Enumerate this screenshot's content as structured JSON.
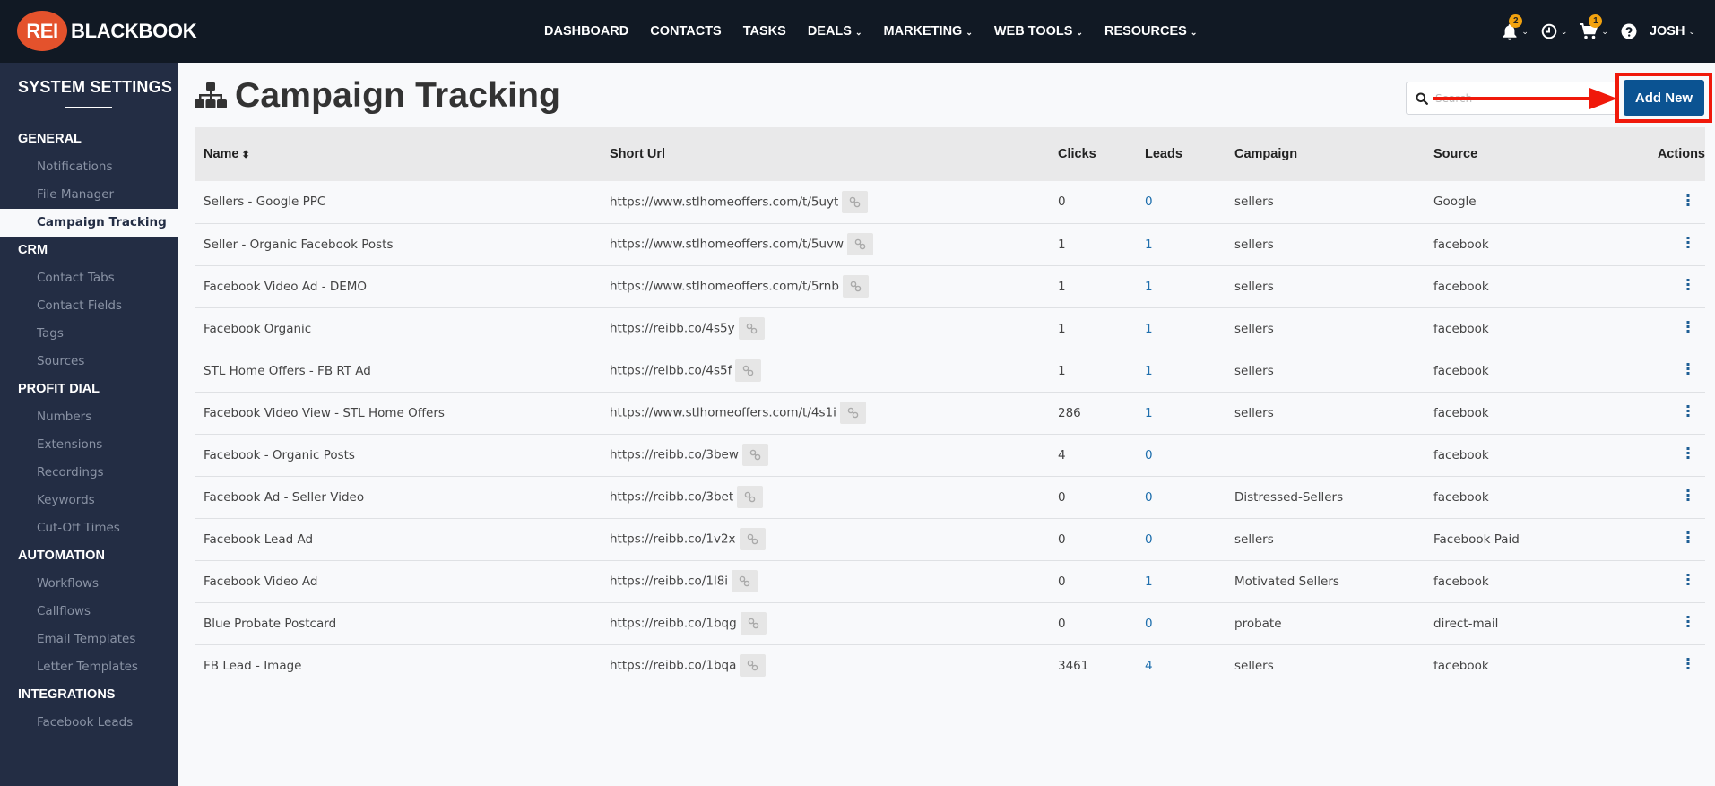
{
  "brand": {
    "logo_mark": "REI",
    "logo_text": "BLACKBOOK",
    "logo_color": "#e4522c"
  },
  "topnav": {
    "items": [
      {
        "label": "DASHBOARD",
        "dropdown": false
      },
      {
        "label": "CONTACTS",
        "dropdown": false
      },
      {
        "label": "TASKS",
        "dropdown": false
      },
      {
        "label": "DEALS",
        "dropdown": true
      },
      {
        "label": "MARKETING",
        "dropdown": true
      },
      {
        "label": "WEB TOOLS",
        "dropdown": true
      },
      {
        "label": "RESOURCES",
        "dropdown": true
      }
    ],
    "caret": "⌄",
    "notifications_badge": "2",
    "cart_badge": "1",
    "user_name": "JOSH"
  },
  "sidebar": {
    "title": "SYSTEM SETTINGS",
    "sections": [
      {
        "label": "GENERAL",
        "items": [
          {
            "label": "Notifications",
            "active": false
          },
          {
            "label": "File Manager",
            "active": false
          },
          {
            "label": "Campaign Tracking",
            "active": true
          }
        ]
      },
      {
        "label": "CRM",
        "items": [
          {
            "label": "Contact Tabs",
            "active": false
          },
          {
            "label": "Contact Fields",
            "active": false
          },
          {
            "label": "Tags",
            "active": false
          },
          {
            "label": "Sources",
            "active": false
          }
        ]
      },
      {
        "label": "PROFIT DIAL",
        "items": [
          {
            "label": "Numbers",
            "active": false
          },
          {
            "label": "Extensions",
            "active": false
          },
          {
            "label": "Recordings",
            "active": false
          },
          {
            "label": "Keywords",
            "active": false
          },
          {
            "label": "Cut-Off Times",
            "active": false
          }
        ]
      },
      {
        "label": "AUTOMATION",
        "items": [
          {
            "label": "Workflows",
            "active": false
          },
          {
            "label": "Callflows",
            "active": false
          },
          {
            "label": "Email Templates",
            "active": false
          },
          {
            "label": "Letter Templates",
            "active": false
          }
        ]
      },
      {
        "label": "INTEGRATIONS",
        "items": [
          {
            "label": "Facebook Leads",
            "active": false
          }
        ]
      }
    ]
  },
  "main": {
    "title": "Campaign Tracking",
    "search_placeholder": "Search",
    "add_new_label": "Add New",
    "accent_color": "#0b5392",
    "annotation_color": "#f0190b",
    "table": {
      "columns": {
        "name": "Name",
        "short_url": "Short Url",
        "clicks": "Clicks",
        "leads": "Leads",
        "campaign": "Campaign",
        "source": "Source",
        "actions": "Actions"
      },
      "sort_icon": "⬍",
      "rows": [
        {
          "name": "Sellers - Google PPC",
          "short_url": "https://www.stlhomeoffers.com/t/5uyt",
          "clicks": "0",
          "leads": "0",
          "campaign": "sellers",
          "source": "Google"
        },
        {
          "name": "Seller - Organic Facebook Posts",
          "short_url": "https://www.stlhomeoffers.com/t/5uvw",
          "clicks": "1",
          "leads": "1",
          "campaign": "sellers",
          "source": "facebook"
        },
        {
          "name": "Facebook Video Ad - DEMO",
          "short_url": "https://www.stlhomeoffers.com/t/5rnb",
          "clicks": "1",
          "leads": "1",
          "campaign": "sellers",
          "source": "facebook"
        },
        {
          "name": "Facebook Organic",
          "short_url": "https://reibb.co/4s5y",
          "clicks": "1",
          "leads": "1",
          "campaign": "sellers",
          "source": "facebook"
        },
        {
          "name": "STL Home Offers - FB RT Ad",
          "short_url": "https://reibb.co/4s5f",
          "clicks": "1",
          "leads": "1",
          "campaign": "sellers",
          "source": "facebook"
        },
        {
          "name": "Facebook Video View - STL Home Offers",
          "short_url": "https://www.stlhomeoffers.com/t/4s1i",
          "clicks": "286",
          "leads": "1",
          "campaign": "sellers",
          "source": "facebook"
        },
        {
          "name": "Facebook - Organic Posts",
          "short_url": "https://reibb.co/3bew",
          "clicks": "4",
          "leads": "0",
          "campaign": "",
          "source": "facebook"
        },
        {
          "name": "Facebook Ad - Seller Video",
          "short_url": "https://reibb.co/3bet",
          "clicks": "0",
          "leads": "0",
          "campaign": "Distressed-Sellers",
          "source": "facebook"
        },
        {
          "name": "Facebook Lead Ad",
          "short_url": "https://reibb.co/1v2x",
          "clicks": "0",
          "leads": "0",
          "campaign": "sellers",
          "source": "Facebook Paid"
        },
        {
          "name": "Facebook Video Ad",
          "short_url": "https://reibb.co/1l8i",
          "clicks": "0",
          "leads": "1",
          "campaign": "Motivated Sellers",
          "source": "facebook"
        },
        {
          "name": "Blue Probate Postcard",
          "short_url": "https://reibb.co/1bqg",
          "clicks": "0",
          "leads": "0",
          "campaign": "probate",
          "source": "direct-mail"
        },
        {
          "name": "FB Lead - Image",
          "short_url": "https://reibb.co/1bqa",
          "clicks": "3461",
          "leads": "4",
          "campaign": "sellers",
          "source": "facebook"
        }
      ]
    }
  }
}
